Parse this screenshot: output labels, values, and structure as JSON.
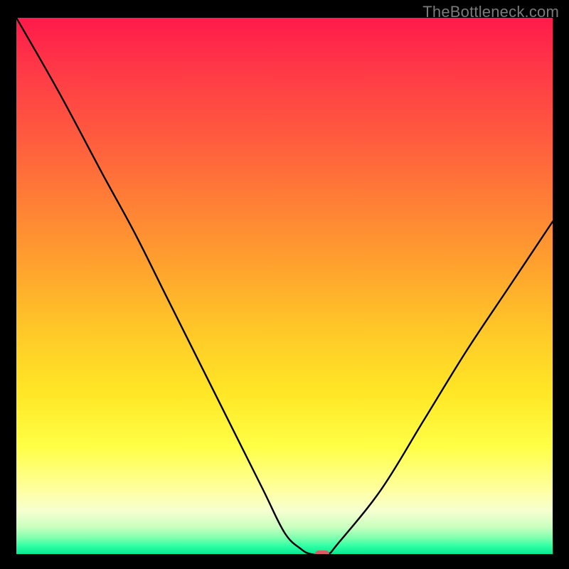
{
  "watermark": "TheBottleneck.com",
  "chart_data": {
    "type": "line",
    "title": "",
    "xlabel": "",
    "ylabel": "",
    "xlim": [
      0,
      100
    ],
    "ylim": [
      0,
      100
    ],
    "legend": false,
    "grid": false,
    "background_gradient": {
      "from": "#ff1a4b",
      "to": "#06e893",
      "direction": "top-to-bottom"
    },
    "series": [
      {
        "name": "bottleneck-curve",
        "color": "#000000",
        "x": [
          0,
          8,
          16,
          22,
          28,
          34,
          40,
          46,
          50,
          53,
          55,
          58,
          60,
          68,
          76,
          84,
          92,
          100
        ],
        "values": [
          100,
          86,
          71,
          60,
          48,
          36,
          24,
          12,
          4,
          1,
          0,
          0,
          2,
          12,
          25,
          38,
          50,
          62
        ]
      }
    ],
    "marker": {
      "name": "optimal-point",
      "x": 57,
      "y": 0,
      "color": "#d95b63"
    }
  }
}
